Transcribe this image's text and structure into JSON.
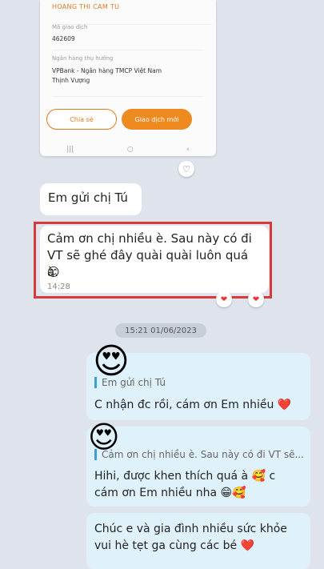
{
  "receipt": {
    "recipient_name": "HOANG THI CAM TU",
    "txn_label": "Mã giao dịch",
    "txn_value": "462609",
    "bank_label": "Ngân hàng thụ hưởng",
    "bank_value_line1": "VPBank - Ngân hàng TMCP Việt Nam",
    "bank_value_line2": "Thịnh Vượng",
    "share_button": "Chia sẻ",
    "new_txn_button": "Giao dịch mới",
    "nav_recent": "|||",
    "nav_home": "○",
    "nav_back": "‹"
  },
  "messages": {
    "m1_text": "Em gửi chị Tú",
    "m2_line1": "Cảm ơn chị nhiều è. Sau này có đi",
    "m2_line2": "VT sẽ ghé đây quài quài luôn quá à.",
    "m2_emoji": "😊",
    "m2_time": "14:28",
    "date_separator": "15:21 01/06/2023",
    "r1_quote": "Em gửi chị Tú",
    "r1_text": "C nhận đc rồi, cám ơn Em nhiều ❤️",
    "r1_emoji": "😍",
    "r2_quote": "Cảm ơn chị nhiều è. Sau này có đi VT sẽ...",
    "r2_line1": "Hihi, được khen thích quá à 🥰 c",
    "r2_line2": "cám ơn Em nhiều nha 😁🥰",
    "r2_emoji": "😍",
    "r3_line1": "Chúc e và gia đình nhiều sức khỏe",
    "r3_line2": "vui hè tẹt ga cùng các bé ❤️"
  },
  "icons": {
    "heart_outline": "♡",
    "heart_filled": "❤"
  }
}
